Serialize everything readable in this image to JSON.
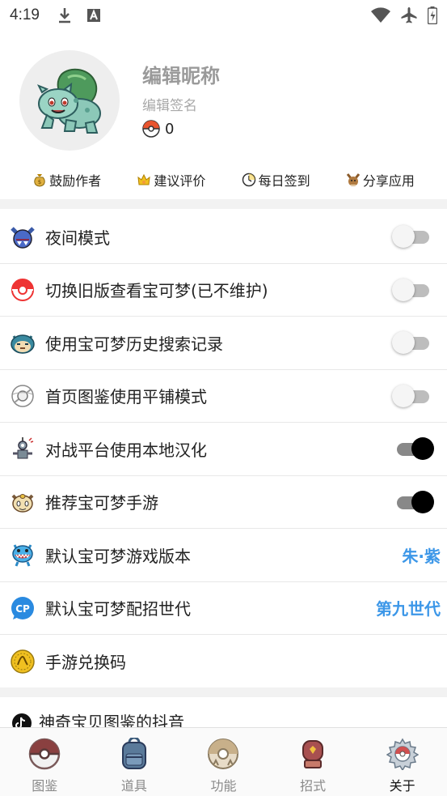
{
  "status_bar": {
    "time": "4:19",
    "left_icons": [
      "download-icon",
      "text-a-icon"
    ],
    "right_icons": [
      "wifi-icon",
      "airplane-icon",
      "battery-icon"
    ]
  },
  "profile": {
    "nickname": "编辑昵称",
    "signature": "编辑签名",
    "coins": "0",
    "avatar_icon": "bulbasaur-avatar"
  },
  "quick_actions": [
    {
      "label": "鼓励作者",
      "icon": "money-bag-icon"
    },
    {
      "label": "建议评价",
      "icon": "crown-icon"
    },
    {
      "label": "每日签到",
      "icon": "clock-icon"
    },
    {
      "label": "分享应用",
      "icon": "eevee-icon"
    }
  ],
  "settings": [
    {
      "label": "夜间模式",
      "icon": "zubat-icon",
      "type": "toggle",
      "on": false
    },
    {
      "label": "切换旧版查看宝可梦(已不维护)",
      "icon": "pokeball-icon",
      "type": "toggle",
      "on": false
    },
    {
      "label": "使用宝可梦历史搜索记录",
      "icon": "snorlax-icon",
      "type": "toggle",
      "on": false
    },
    {
      "label": "首页图鉴使用平铺模式",
      "icon": "pokedex-icon",
      "type": "toggle",
      "on": false
    },
    {
      "label": "对战平台使用本地汉化",
      "icon": "magnemite-icon",
      "type": "toggle",
      "on": true
    },
    {
      "label": "推荐宝可梦手游",
      "icon": "meowth-icon",
      "type": "toggle",
      "on": true
    },
    {
      "label": "默认宝可梦游戏版本",
      "icon": "totodile-icon",
      "type": "value",
      "value": "朱·紫"
    },
    {
      "label": "默认宝可梦配招世代",
      "icon": "cp-icon",
      "type": "value",
      "value": "第九世代"
    },
    {
      "label": "手游兑换码",
      "icon": "coin-icon",
      "type": "none"
    }
  ],
  "douyin": {
    "label": "神奇宝贝图鉴的抖音",
    "icon": "tiktok-icon"
  },
  "bottom_nav": [
    {
      "label": "图鉴",
      "icon": "pokeball-nav-icon",
      "active": false
    },
    {
      "label": "道具",
      "icon": "backpack-icon",
      "active": false
    },
    {
      "label": "功能",
      "icon": "function-icon",
      "active": false
    },
    {
      "label": "招式",
      "icon": "boxing-glove-icon",
      "active": false
    },
    {
      "label": "关于",
      "icon": "settings-gear-icon",
      "active": true
    }
  ],
  "colors": {
    "accent": "#3c97e8",
    "toggle_on": "#000000",
    "toggle_off": "#f5f5f5"
  }
}
